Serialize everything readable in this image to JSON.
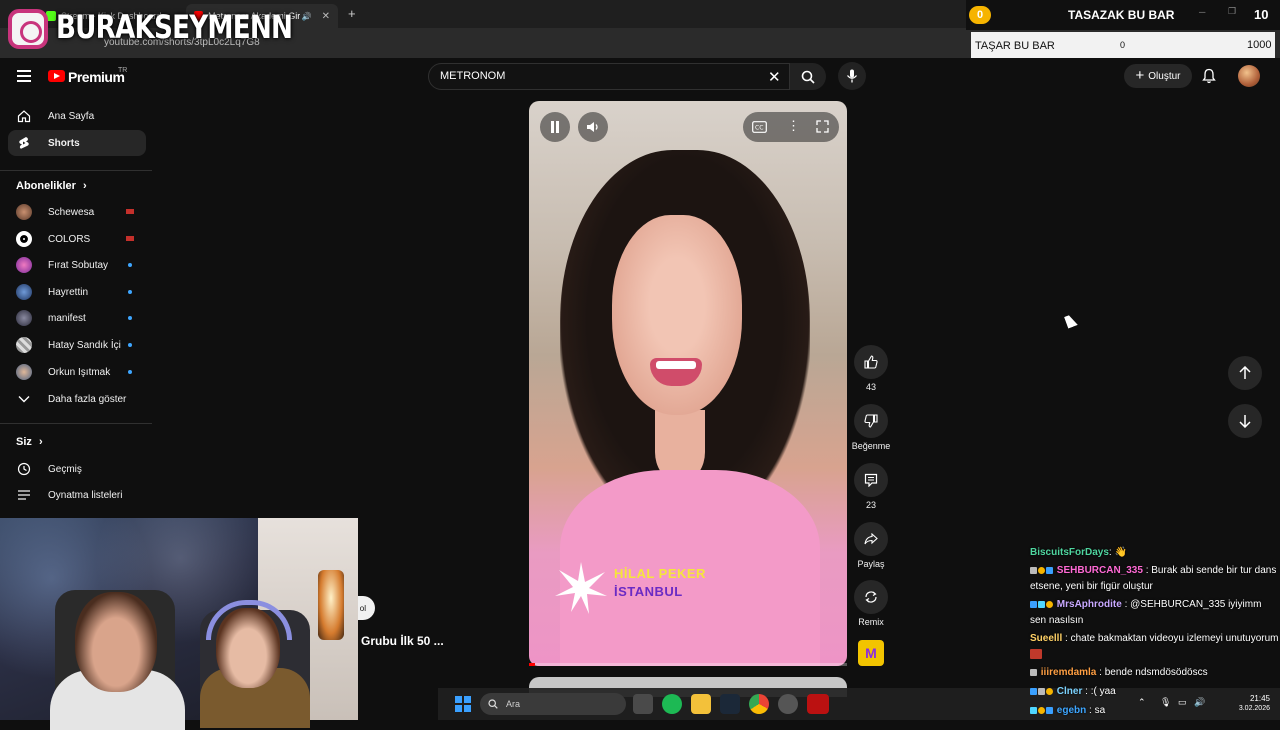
{
  "browser": {
    "tabs": [
      {
        "label": "Stream - Kick Dashboard"
      },
      {
        "label": "Metronom Akademi Girl Ba"
      }
    ],
    "url": "youtube.com/shorts/3tpL0c2Lq7G8"
  },
  "overlay": {
    "streamer_name": "BURAKSEYMENN",
    "bar": {
      "coin": "0",
      "title": "TASAZAK BU BAR",
      "count": "10",
      "label": "TAŞAR BU BAR",
      "min": "0",
      "max": "1000",
      "progress_fraction": 0
    }
  },
  "header": {
    "brand": "Premium",
    "region": "TR",
    "search": {
      "value": "METRONOM"
    },
    "create_label": "Oluştur"
  },
  "sidebar": {
    "main_items": [
      {
        "label": "Ana Sayfa",
        "icon": "home-icon"
      },
      {
        "label": "Shorts",
        "icon": "shorts-icon"
      }
    ],
    "subscriptions_title": "Abonelikler",
    "subscriptions": [
      {
        "label": "Schewesa",
        "status": "live"
      },
      {
        "label": "COLORS",
        "status": "live"
      },
      {
        "label": "Fırat Sobutay",
        "status": "new"
      },
      {
        "label": "Hayrettin",
        "status": "new"
      },
      {
        "label": "manifest",
        "status": "new"
      },
      {
        "label": "Hatay Sandık İçi",
        "status": "new"
      },
      {
        "label": "Orkun Işıtmak",
        "status": "new"
      }
    ],
    "show_more": "Daha fazla göster",
    "you_title": "Siz",
    "you_items": [
      {
        "label": "Geçmiş",
        "icon": "history-icon"
      },
      {
        "label": "Oynatma listeleri",
        "icon": "playlist-icon"
      }
    ]
  },
  "short": {
    "brand_line1": "HİLAL PEKER",
    "brand_line2": "İSTANBUL",
    "progress_fraction": 0.02,
    "actions": {
      "likes": "43",
      "dislike_label": "Beğenme",
      "comments": "23",
      "share_label": "Paylaş",
      "remix_label": "Remix"
    }
  },
  "side_peek": {
    "chip": "ol",
    "title": "Grubu İlk 50 ..."
  },
  "taskbar": {
    "search_placeholder": "Ara",
    "time": "21:45",
    "date": "3.02.2026"
  },
  "chat": [
    {
      "user": "BiscuitsForDays",
      "color": "#4fd6a0",
      "sep": ":",
      "text": "👋"
    },
    {
      "user": "SEHBURCAN_335",
      "color": "#ff6ad5",
      "sep": ":",
      "text": "Burak abi sende bir tur dans etsene, yeni bir figür oluştur"
    },
    {
      "user": "MrsAphrodite",
      "color": "#c8a8ff",
      "sep": ":",
      "text": "@SEHBURCAN_335 iyiyimm sen nasılsın"
    },
    {
      "user": "Sueelll",
      "color": "#ffd166",
      "sep": ":",
      "text": "chate bakmaktan videoyu izlemeyi unutuyorum"
    },
    {
      "user": "iiiremdamla",
      "color": "#ff9f43",
      "sep": ":",
      "text": "bende ndsmdösödöscs"
    },
    {
      "user": "Clner",
      "color": "#7cd3ff",
      "sep": ":",
      "text": ":( yaa"
    },
    {
      "user": "egebn",
      "color": "#3ea6ff",
      "sep": ":",
      "text": "sa"
    }
  ]
}
